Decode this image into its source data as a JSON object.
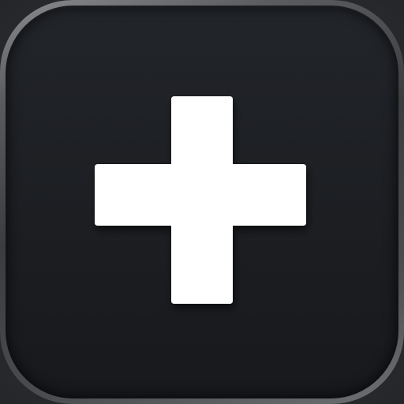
{
  "icon": {
    "glyph": "plus-icon",
    "glyph_color": "#ffffff",
    "face_color": "#1e2024",
    "rim_color": "#5c5e62"
  }
}
